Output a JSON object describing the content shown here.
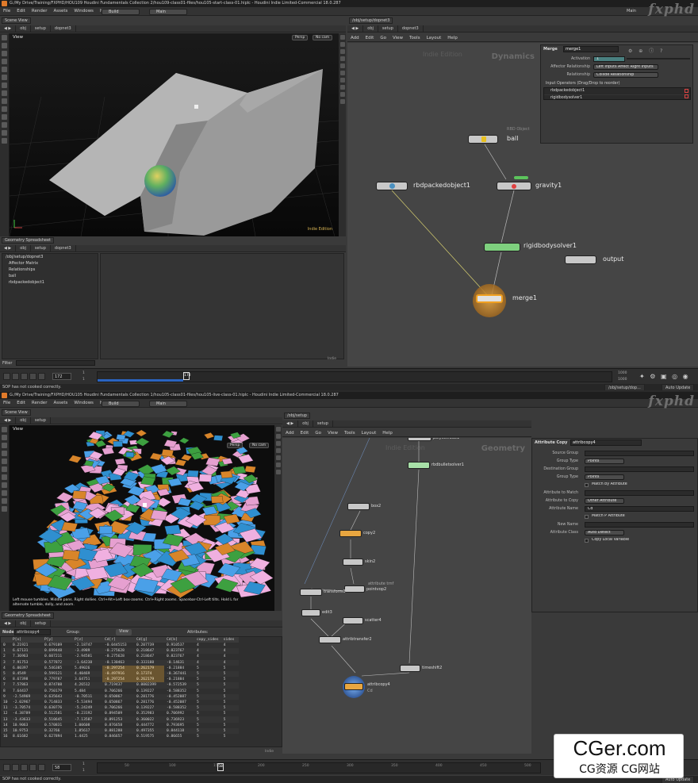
{
  "watermarks": {
    "top": "fxphd",
    "bottom": "fxphd"
  },
  "site_badge": {
    "text": "CGer.com",
    "sub": "CG资源 CG网站"
  },
  "window1": {
    "title": "G:/My Drive/Training/FXPHD/HOU109 Houdini Fundamentals Collection 2/hou109-class01-files/hou105-start-class-01.hiplc - Houdini Indie Limited-Commercial 18.0.287",
    "menu": [
      "File",
      "Edit",
      "Render",
      "Assets",
      "Windows",
      "Help"
    ],
    "build": "Build",
    "desktop": "Main",
    "right_desktop": "Main",
    "scene_tab": "Scene View",
    "path": [
      "obj",
      "setup",
      "dopnet3"
    ],
    "viewport": {
      "label": "View",
      "persp": "Persp",
      "cam": "No cam",
      "indie": "Indie Edition"
    },
    "spreadsheet": {
      "tab": "Geometry Spreadsheet",
      "path": [
        "obj",
        "setup",
        "dopnet3"
      ],
      "tree": [
        "/obj/setup/dopnet3",
        "Affector Matrix",
        "Relationships",
        "ball",
        "rbdpackedobject1"
      ],
      "filter": "Filter",
      "foot": "Indie"
    },
    "net": {
      "tab": "/obj/setup/dopnet3",
      "path": [
        "obj",
        "setup",
        "dopnet3"
      ],
      "menu": [
        "Add",
        "Edit",
        "Go",
        "View",
        "Tools",
        "Layout",
        "Help"
      ],
      "context": "Dynamics",
      "indie": "Indie Edition",
      "nodes": {
        "ball_type": "RBD Object",
        "ball": "ball",
        "rbd": "rbdpackedobject1",
        "gravity": "gravity1",
        "solver": "rigidbodysolver1",
        "output": "output",
        "merge": "merge1"
      }
    },
    "params": {
      "type": "Merge",
      "name": "merge1",
      "activation_label": "Activation",
      "activation": "1",
      "affector_label": "Affector Relationship",
      "affector": "Left Inputs Affect Right Inputs",
      "relationship_label": "Relationship",
      "relationship": "Collide Relationship",
      "inputs_label": "Input Operators (Drag/Drop to reorder)",
      "inputs": [
        "rbdpackedobject1",
        "rigidbodysolver1"
      ]
    },
    "timeline": {
      "frame": "172",
      "start": "1",
      "start2": "1",
      "end": "1000",
      "end2": "1000",
      "cursor": "172",
      "ticks": [
        "1",
        "",
        "",
        "",
        "",
        "",
        "",
        "",
        "",
        "",
        "",
        "",
        "",
        "",
        "",
        "",
        "",
        "",
        "",
        "",
        "",
        "",
        "",
        "",
        "",
        "",
        "1000"
      ]
    },
    "status": "SOP has not cooked correctly.",
    "status_right": [
      "/obj/setup/dop...",
      "Auto Update"
    ]
  },
  "window2": {
    "title": "G:/My Drive/Training/FXPHD/HOU105 Houdini Fundamentals Collection 1/hou105-class01-files/hou105-live-class-01.hiplc - Houdini Indie Limited-Commercial 18.0.287",
    "menu": [
      "File",
      "Edit",
      "Render",
      "Assets",
      "Windows",
      "Help"
    ],
    "build": "Build",
    "desktop": "Main",
    "scene_tab": "Scene View",
    "path": [
      "obj",
      "setup"
    ],
    "viewport": {
      "label": "View",
      "persp": "Persp",
      "cam": "No cam",
      "hint": "Left mouse tumbles. Middle pans. Right dollies. Ctrl+Alt+Left box-zooms. Ctrl+Right zooms. Spacebar-Ctrl-Left tilts. Hold L for alternate tumble, dolly, and zoom."
    },
    "spreadsheet": {
      "tab": "Geometry Spreadsheet",
      "path": [
        "obj",
        "setup"
      ],
      "node_label": "Node:",
      "node": "attribcopy4",
      "group_label": "Group:",
      "view": "View",
      "attrs": "Attributes:",
      "columns": [
        "",
        "P[x]",
        "P[y]",
        "P[z]",
        "Cd[r]",
        "Cd[g]",
        "Cd[b]",
        "copy_sides",
        "sides"
      ],
      "rows": [
        [
          "0",
          "0.21921",
          "0.679109",
          "-2.18747",
          "-0.0445153",
          "0.207739",
          "0.910537",
          "4",
          "4"
        ],
        [
          "1",
          "6.67131",
          "0.699448",
          "-3.4989",
          "-0.275628",
          "0.218647",
          "0.823767",
          "4",
          "4"
        ],
        [
          "2",
          "7.36963",
          "0.607211",
          "-2.94581",
          "-0.275628",
          "0.218647",
          "0.823767",
          "4",
          "4"
        ],
        [
          "3",
          "7.91753",
          "0.577872",
          "-1.64238",
          "-0.130463",
          "0.333188",
          "-0.14631",
          "4",
          "4"
        ],
        [
          "4",
          "6.00397",
          "0.546385",
          "5.49026",
          "-0.297254",
          "0.262179",
          "-0.21884",
          "5",
          "5"
        ],
        [
          "5",
          "8.4549",
          "0.599121",
          "4.40469",
          "-0.497916",
          "0.17374",
          "-0.367441",
          "5",
          "5"
        ],
        [
          "6",
          "8.67398",
          "0.779787",
          "3.64751",
          "-0.297254",
          "0.262179",
          "-0.21884",
          "5",
          "5"
        ],
        [
          "7",
          "7.57863",
          "0.874708",
          "4.26512",
          "0.719437",
          "0.0002399",
          "-0.572539",
          "5",
          "5"
        ],
        [
          "8",
          "7.64437",
          "0.750179",
          "5.484",
          "0.706266",
          "0.139227",
          "-0.588352",
          "5",
          "5"
        ],
        [
          "9",
          "-2.54969",
          "0.635643",
          "-0.70511",
          "0.650867",
          "0.281776",
          "-0.452087",
          "5",
          "5"
        ],
        [
          "10",
          "-2.02967",
          "0.714833",
          "-5.53494",
          "0.650867",
          "0.281776",
          "-0.452087",
          "5",
          "5"
        ],
        [
          "11",
          "-3.70574",
          "0.630776",
          "-5.24249",
          "0.706266",
          "0.139227",
          "-0.588352",
          "5",
          "5"
        ],
        [
          "12",
          "-4.38789",
          "0.512581",
          "-0.23192",
          "0.894509",
          "0.352983",
          "0.706992",
          "5",
          "5"
        ],
        [
          "13",
          "-3.43633",
          "0.510645",
          "-7.13587",
          "0.891253",
          "0.360022",
          "0.736923",
          "5",
          "5"
        ],
        [
          "14",
          "10.9063",
          "0.570831",
          "1.00608",
          "0.876658",
          "0.444772",
          "0.793695",
          "5",
          "5"
        ],
        [
          "15",
          "10.9753",
          "0.32766",
          "1.85617",
          "0.881288",
          "0.497355",
          "0.844118",
          "5",
          "5"
        ],
        [
          "16",
          "8.61682",
          "0.627894",
          "1.4425",
          "0.846657",
          "0.519575",
          "0.86655",
          "5",
          "5"
        ]
      ],
      "foot": "Indie"
    },
    "net": {
      "tab": "/obj/setup",
      "path": [
        "obj",
        "setup"
      ],
      "menu": [
        "Add",
        "Edit",
        "Go",
        "View",
        "Tools",
        "Layout",
        "Help"
      ],
      "context": "Geometry",
      "indie": "Indie Edition",
      "nodes": {
        "top": "polyextrude1",
        "rbd": "rbdbulletsolver1",
        "box": "box2",
        "copy": "copy2",
        "skin": "skin2",
        "pm_label": "attribute trnf",
        "pointvop": "pointvop2",
        "transform": "transform3",
        "edit": "edit3",
        "scatter": "scatter4",
        "attribtransfer": "attribtransfer2",
        "timeshift": "timeshift2",
        "attribcopy": "attribcopy4",
        "cd": "Cd"
      }
    },
    "params": {
      "type": "Attribute Copy",
      "name": "attribcopy4",
      "rows": [
        {
          "k": "Source Group",
          "v": ""
        },
        {
          "k": "Group Type",
          "v": "Points"
        },
        {
          "k": "Destination Group",
          "v": ""
        },
        {
          "k": "Group Type",
          "v": "Points"
        },
        {
          "k": "",
          "v": "Match by Attribute"
        },
        {
          "k": "Attribute to Match",
          "v": ""
        },
        {
          "k": "Attribute to Copy",
          "v": "Other Attribute"
        },
        {
          "k": "Attribute Name",
          "v": "Cd"
        },
        {
          "k": "",
          "v": "Match P Attribute"
        },
        {
          "k": "New Name",
          "v": ""
        },
        {
          "k": "Attribute Class",
          "v": "Auto Detect"
        },
        {
          "k": "",
          "v": "Copy Local Variable"
        }
      ]
    },
    "timeline": {
      "frame": "58",
      "start": "1",
      "start2": "1",
      "cursor": "58",
      "ticks": [
        "50",
        "100",
        "150",
        "200",
        "250",
        "300",
        "350",
        "400",
        "450",
        "500"
      ]
    },
    "status": "SOP has not cooked correctly.",
    "status_right": [
      "Auto Update"
    ]
  },
  "colors": {
    "merge": "#e8a640",
    "solver": "#7ed07e",
    "gravity_flag": "#5cc45c",
    "cd_node": "#5aa0e0",
    "selected_border": "#f0a020"
  }
}
